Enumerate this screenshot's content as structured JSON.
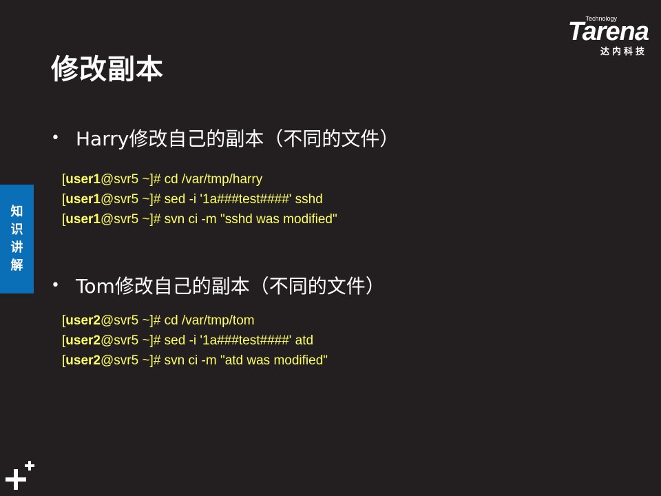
{
  "title": "修改副本",
  "logo": {
    "technology": "Technology",
    "word": "Tarena",
    "subtitle": "达内科技"
  },
  "side_tab": [
    "知",
    "识",
    "讲",
    "解"
  ],
  "sections": [
    {
      "bullet": "Harry修改自己的副本（不同的文件）",
      "lines": [
        {
          "user": "user1",
          "host": "@svr5 ~]#",
          "cmd": " cd /var/tmp/harry"
        },
        {
          "user": "user1",
          "host": "@svr5 ~]#",
          "cmd": " sed -i '1a###test####' sshd"
        },
        {
          "user": "user1",
          "host": "@svr5 ~]#",
          "cmd": " svn ci -m \"sshd was modified\""
        }
      ]
    },
    {
      "bullet": "Tom修改自己的副本（不同的文件）",
      "lines": [
        {
          "user": "user2",
          "host": "@svr5 ~]#",
          "cmd": " cd /var/tmp/tom"
        },
        {
          "user": "user2",
          "host": "@svr5 ~]#",
          "cmd": " sed -i '1a###test####' atd"
        },
        {
          "user": "user2",
          "host": "@svr5 ~]#",
          "cmd": " svn ci -m \"atd was modified\""
        }
      ]
    }
  ],
  "colors": {
    "background": "#231f20",
    "code": "#ffff66",
    "side_tab": "#0b6fb8"
  }
}
